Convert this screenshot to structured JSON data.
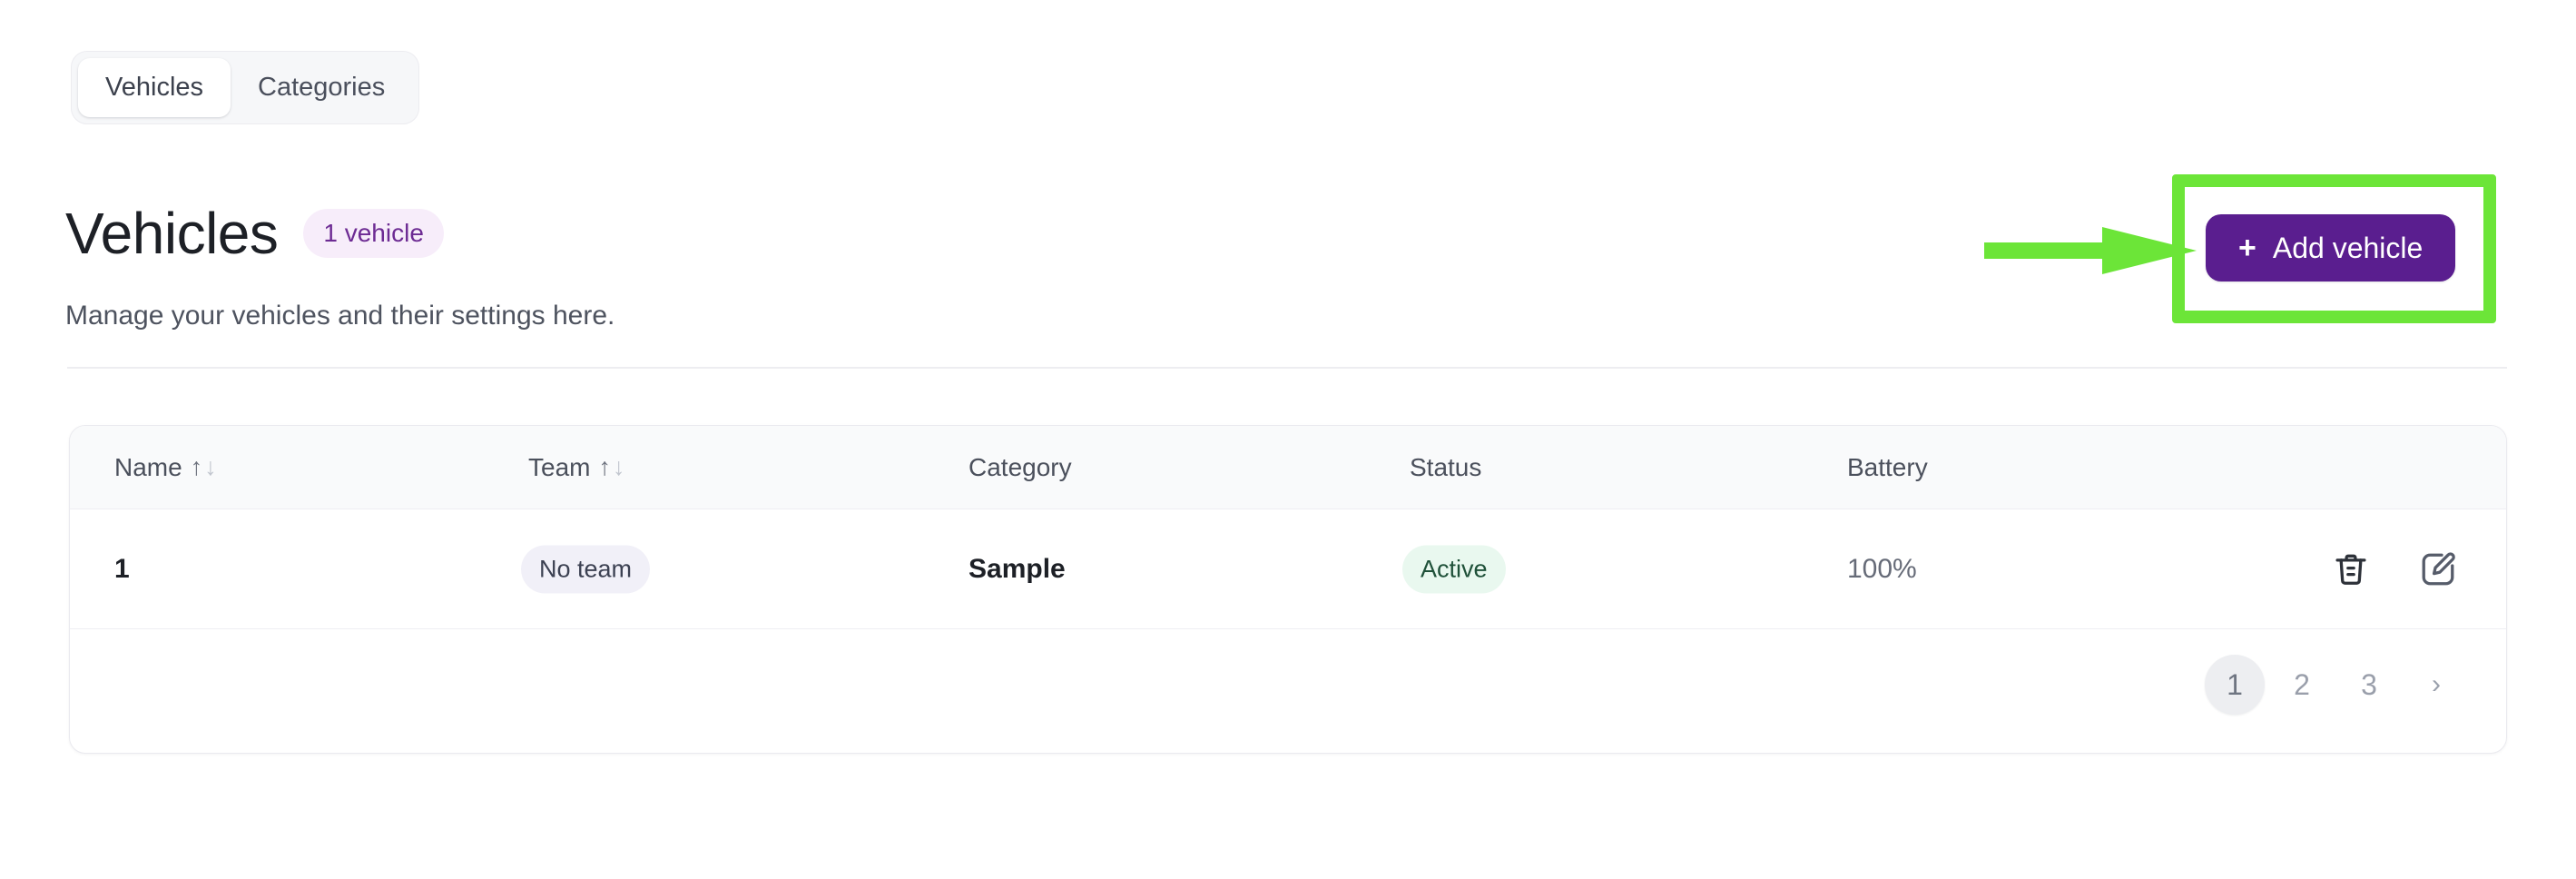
{
  "tabs": [
    {
      "label": "Vehicles",
      "active": true
    },
    {
      "label": "Categories",
      "active": false
    }
  ],
  "header": {
    "title": "Vehicles",
    "count_badge": "1 vehicle",
    "subtitle": "Manage your vehicles and their settings here.",
    "add_button": {
      "plus": "+",
      "label": "Add vehicle"
    }
  },
  "annotation": {
    "highlight_color": "#6ce538",
    "arrow": "right-arrow",
    "target": "add-vehicle-button"
  },
  "colors": {
    "brand_purple": "#5a1e8f",
    "badge_purple_bg": "#f7edfa",
    "badge_purple_text": "#6d2b93",
    "badge_team_bg": "#f1f0f8",
    "badge_active_bg": "#e9f8ef",
    "badge_active_text": "#1f5139",
    "highlight_green": "#6ce538"
  },
  "table": {
    "columns": [
      {
        "label": "Name",
        "sortable": true,
        "sort_up": "↑",
        "sort_down": "↓"
      },
      {
        "label": "Team",
        "sortable": true,
        "sort_up": "↑",
        "sort_down": "↓"
      },
      {
        "label": "Category",
        "sortable": false
      },
      {
        "label": "Status",
        "sortable": false
      },
      {
        "label": "Battery",
        "sortable": false
      }
    ],
    "rows": [
      {
        "name": "1",
        "team": "No team",
        "category": "Sample",
        "status": "Active",
        "battery": "100%",
        "actions": [
          "delete-icon",
          "edit-icon"
        ]
      }
    ]
  },
  "pagination": {
    "pages": [
      "1",
      "2",
      "3"
    ],
    "current": "1",
    "next_label": "›"
  }
}
